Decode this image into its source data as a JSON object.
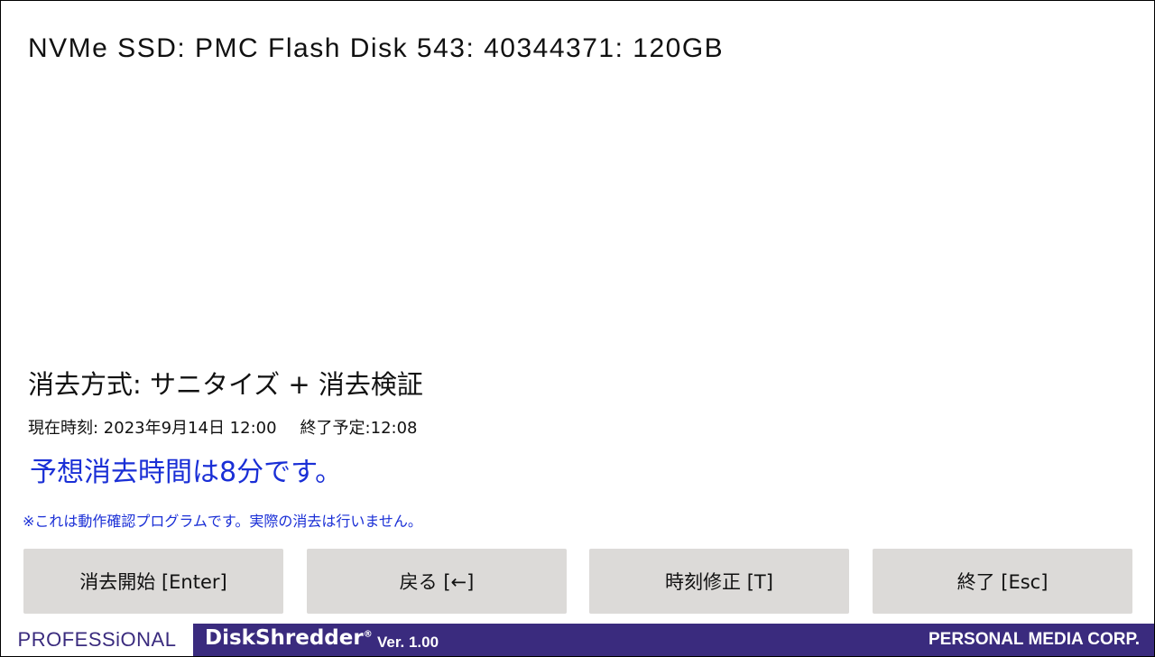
{
  "disk": {
    "title": "NVMe SSD: PMC Flash Disk 543: 40344371: 120GB"
  },
  "erase": {
    "method": "消去方式: サニタイズ + 消去検証",
    "current_time": "現在時刻: 2023年9月14日 12:00",
    "end_time": "終了予定:12:08",
    "estimate": "予想消去時間は8分です。",
    "note": "※これは動作確認プログラムです。実際の消去は行いません。"
  },
  "buttons": {
    "start": "消去開始 [Enter]",
    "back": "戻る [←]",
    "time_adjust": "時刻修正 [T]",
    "quit": "終了 [Esc]"
  },
  "footer": {
    "brand": "PROFESSiONAL",
    "product": "DiskShredder",
    "registered_mark": "®",
    "version": "Ver. 1.00",
    "company": "PERSONAL MEDIA CORP."
  },
  "colors": {
    "accent_blue": "#1a2fd6",
    "footer_purple": "#3a2b7e",
    "button_gray": "#dcdad8"
  }
}
